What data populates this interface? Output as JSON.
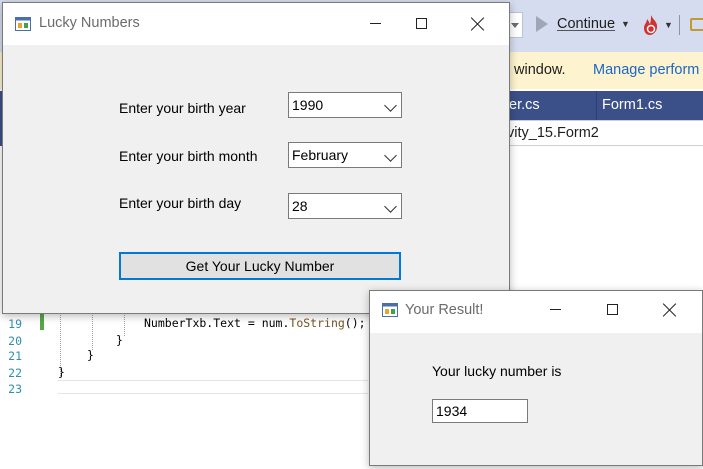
{
  "ide": {
    "continue_label": "Continue",
    "info_message": "window.",
    "info_link": "Manage perform",
    "tabs": [
      "er.cs",
      "Form1.cs"
    ],
    "nav_member": "vity_15.Form2",
    "code_lines": [
      {
        "num": "19",
        "text_plain": "NumberTxb.Text = num.",
        "method": "ToString",
        "text_tail": "();"
      },
      {
        "num": "20",
        "text": "}"
      },
      {
        "num": "21",
        "text": "}"
      },
      {
        "num": "22",
        "text": "}"
      },
      {
        "num": "23",
        "text": ""
      }
    ]
  },
  "lucky_window": {
    "title": "Lucky Numbers",
    "year_label": "Enter your birth year",
    "year_value": "1990",
    "month_label": "Enter your birth month",
    "month_value": "February",
    "day_label": "Enter your birth day",
    "day_value": "28",
    "button_label": "Get Your Lucky Number"
  },
  "result_window": {
    "title": "Your Result!",
    "message": "Your lucky number is",
    "value": "1934"
  },
  "colors": {
    "accent": "#0078d7",
    "ide_tab_bar": "#3b5088",
    "info_bar": "#fdf3cf",
    "link": "#1a67c9"
  },
  "icons": [
    "app-icon",
    "minimize-icon",
    "maximize-icon",
    "close-icon",
    "play-icon",
    "fire-icon",
    "folder-icon",
    "chevron-down-icon"
  ]
}
